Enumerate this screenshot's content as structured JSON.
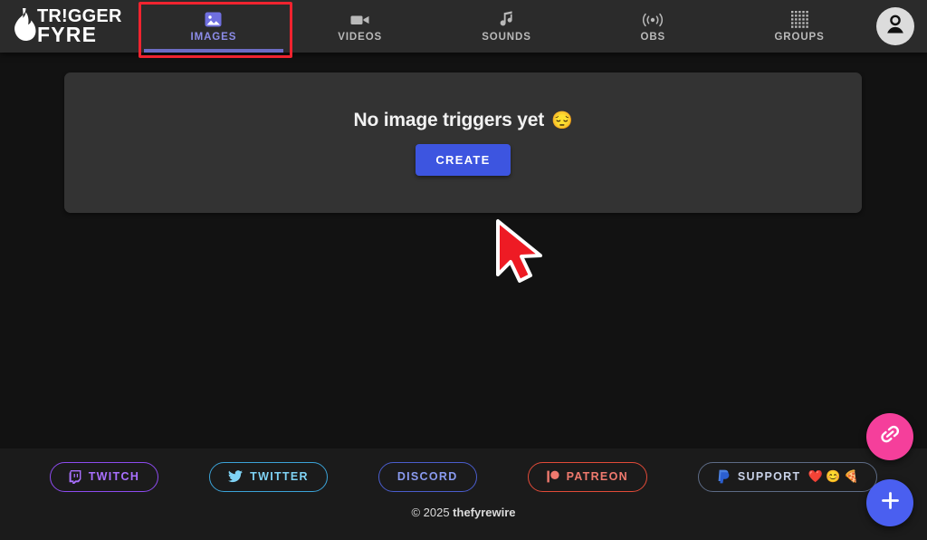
{
  "brand": {
    "line1": "TR!GGER",
    "line2": "FYRE",
    "icon": "flame-icon"
  },
  "nav": {
    "tabs": [
      {
        "label": "IMAGES",
        "icon": "image-icon",
        "active": true
      },
      {
        "label": "VIDEOS",
        "icon": "video-camera-icon",
        "active": false
      },
      {
        "label": "SOUNDS",
        "icon": "music-note-icon",
        "active": false
      },
      {
        "label": "OBS",
        "icon": "broadcast-icon",
        "active": false
      },
      {
        "label": "GROUPS",
        "icon": "grid-dots-icon",
        "active": false
      }
    ],
    "avatar_icon": "user-avatar-icon",
    "active_color": "#8c8ce8",
    "inactive_color": "#b9b9b9",
    "underline_color": "#6c6cc4",
    "annotation_color": "#f0232f"
  },
  "main": {
    "empty_state_heading": "No image triggers yet",
    "empty_state_emoji": "😔",
    "create_label": "CREATE",
    "create_color": "#3d55e0",
    "panel_color": "#333333",
    "cursor_icon": "mouse-pointer-icon"
  },
  "footer": {
    "social": [
      {
        "label": "TWITCH",
        "icon": "twitch-icon",
        "color": "#a970ff",
        "border": "#8d4bf0"
      },
      {
        "label": "TWITTER",
        "icon": "twitter-icon",
        "color": "#7fd3f5",
        "border": "#3ba3d8"
      },
      {
        "label": "DISCORD",
        "icon": "discord-icon",
        "color": "#8a9bf0",
        "border": "#4a5dcd"
      },
      {
        "label": "PATREON",
        "icon": "patreon-icon",
        "color": "#f07a6e",
        "border": "#e14a38"
      },
      {
        "label": "SUPPORT",
        "icon": "paypal-icon",
        "color": "#c9d2e8",
        "border": "#5d6b86",
        "emojis": "❤️ 😊 🍕"
      }
    ],
    "copyright_prefix": "© 2025 ",
    "copyright_brand": "thefyrewire"
  },
  "fabs": [
    {
      "name": "link-fab",
      "icon": "link-icon",
      "color": "#f53f9b"
    },
    {
      "name": "add-fab",
      "icon": "plus-icon",
      "color": "#4a5ff0"
    }
  ]
}
